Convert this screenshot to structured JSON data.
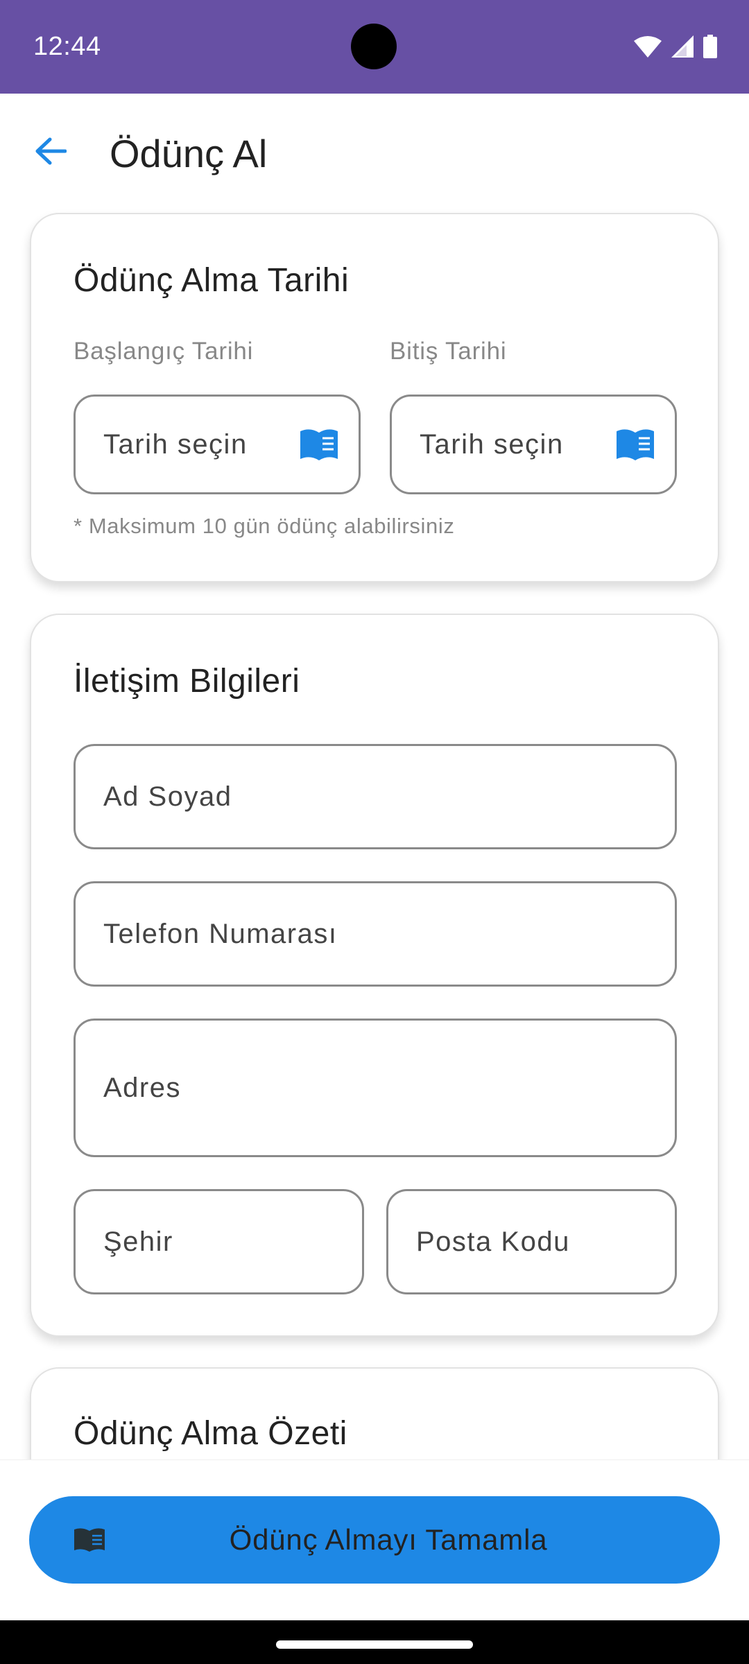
{
  "status_bar": {
    "time": "12:44"
  },
  "app_bar": {
    "title": "Ödünç Al"
  },
  "date_card": {
    "title": "Ödünç Alma Tarihi",
    "start_label": "Başlangıç Tarihi",
    "end_label": "Bitiş Tarihi",
    "start_placeholder": "Tarih seçin",
    "end_placeholder": "Tarih seçin",
    "hint": "* Maksimum 10 gün ödünç alabilirsiniz"
  },
  "contact_card": {
    "title": "İletişim Bilgileri",
    "fields": {
      "name": "Ad Soyad",
      "phone": "Telefon Numarası",
      "address": "Adres",
      "city": "Şehir",
      "postal": "Posta Kodu"
    }
  },
  "summary_card": {
    "title": "Ödünç Alma Özeti"
  },
  "cta": {
    "label": "Ödünç Almayı Tamamla"
  },
  "colors": {
    "status_bar": "#6750A4",
    "accent": "#1E88E5"
  },
  "icons": {
    "back": "arrow-left-icon",
    "date_picker": "open-book-icon",
    "cta": "book-icon"
  }
}
